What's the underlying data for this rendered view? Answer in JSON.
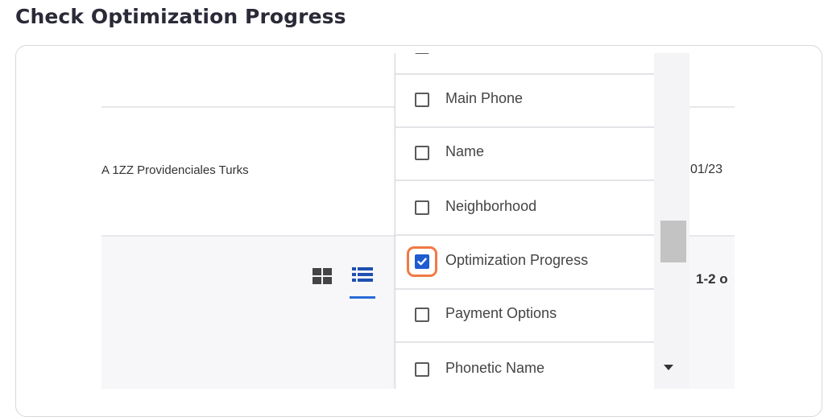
{
  "page": {
    "title": "Check Optimization Progress"
  },
  "table": {
    "address_text": "A 1ZZ Providenciales Turks",
    "date_text": "01/23",
    "pagination_text": "1-2 o"
  },
  "view_toggle": {
    "grid_icon": "grid-view-icon",
    "list_icon": "list-view-icon",
    "active": "list"
  },
  "dropdown": {
    "options": [
      {
        "label": "Main Phone",
        "checked": false
      },
      {
        "label": "Name",
        "checked": false
      },
      {
        "label": "Neighborhood",
        "checked": false
      },
      {
        "label": "Optimization Progress",
        "checked": true
      },
      {
        "label": "Payment Options",
        "checked": false
      },
      {
        "label": "Phonetic Name",
        "checked": false
      }
    ]
  },
  "colors": {
    "checkbox_checked": "#1f5bd1",
    "focus_ring": "#f07a45",
    "active_view_underline": "#2a6ad8"
  }
}
